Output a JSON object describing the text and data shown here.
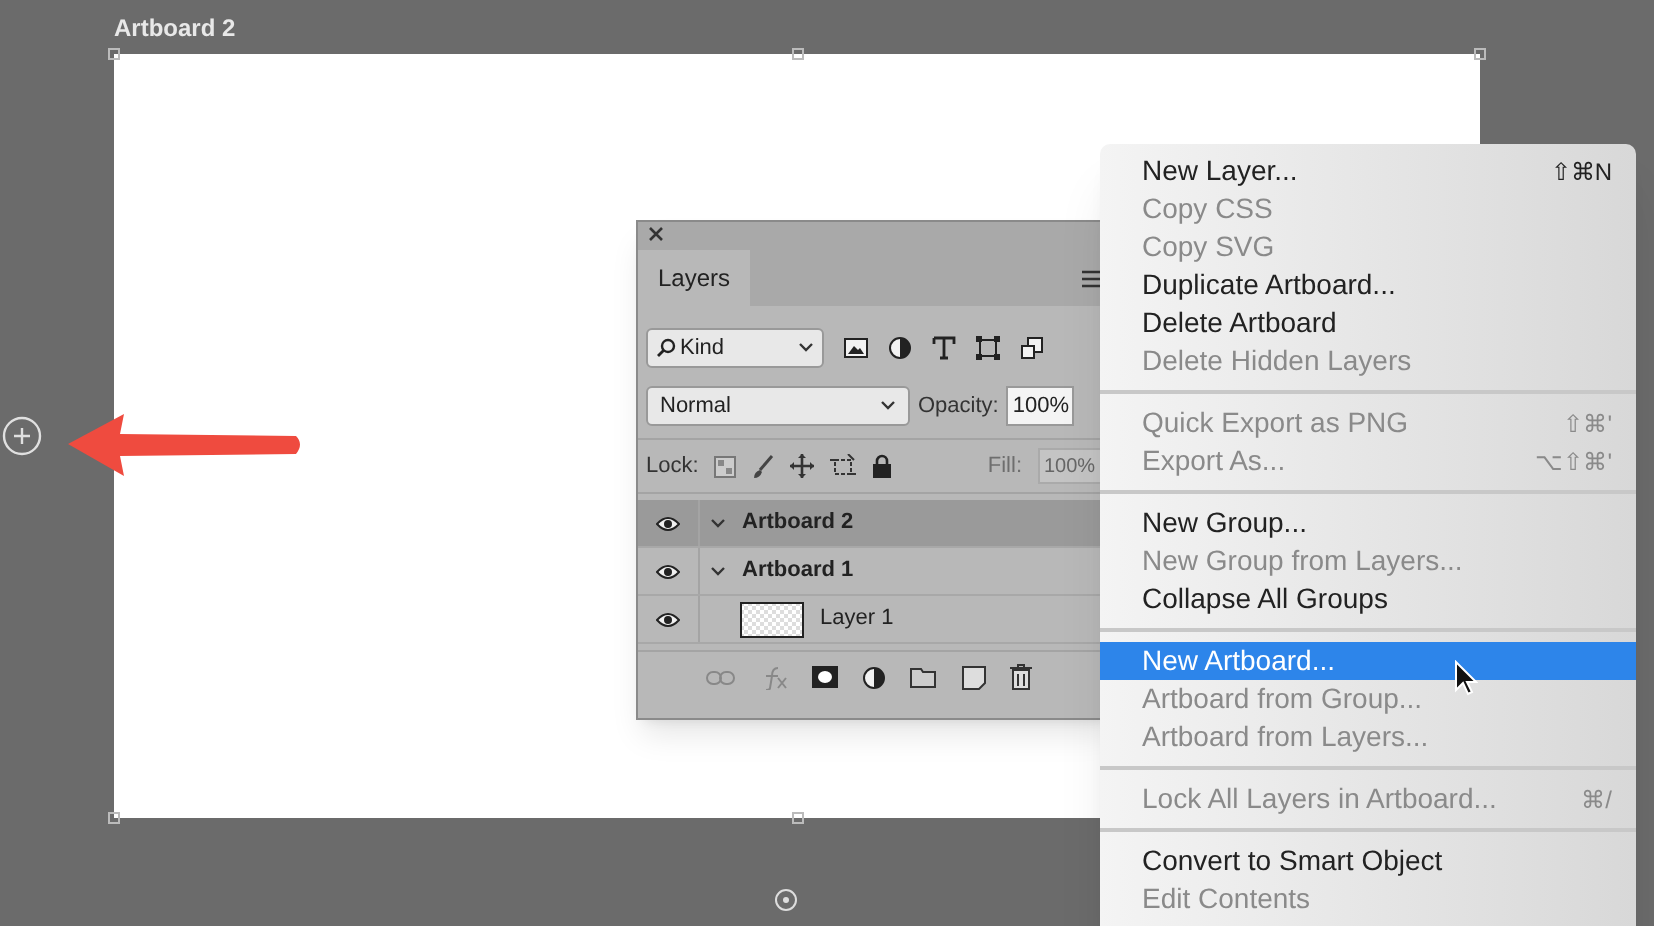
{
  "artboard": {
    "title": "Artboard 2"
  },
  "layers_panel": {
    "tab": {
      "label": "Layers",
      "selected": true
    },
    "filter": {
      "value": "Kind"
    },
    "blend_mode": {
      "value": "Normal"
    },
    "opacity": {
      "label": "Opacity:",
      "value": "100%"
    },
    "lock": {
      "label": "Lock:"
    },
    "fill": {
      "label": "Fill:",
      "value": "100%",
      "disabled": true
    },
    "layers": [
      {
        "name": "Artboard 2",
        "kind": "artboard",
        "visible": true,
        "selected": true,
        "expanded": true
      },
      {
        "name": "Artboard 1",
        "kind": "artboard",
        "visible": true,
        "selected": false,
        "expanded": true,
        "children": [
          {
            "name": "Layer 1",
            "kind": "layer",
            "visible": true,
            "selected": false
          }
        ]
      }
    ]
  },
  "context_menu": {
    "items": [
      {
        "kind": "item",
        "label": "New Layer...",
        "shortcut": "⇧⌘N",
        "disabled": false,
        "selected": false
      },
      {
        "kind": "item",
        "label": "Copy CSS",
        "disabled": true,
        "selected": false
      },
      {
        "kind": "item",
        "label": "Copy SVG",
        "disabled": true,
        "selected": false
      },
      {
        "kind": "item",
        "label": "Duplicate Artboard...",
        "disabled": false,
        "selected": false
      },
      {
        "kind": "item",
        "label": "Delete Artboard",
        "disabled": false,
        "selected": false
      },
      {
        "kind": "item",
        "label": "Delete Hidden Layers",
        "disabled": true,
        "selected": false
      },
      {
        "kind": "separator"
      },
      {
        "kind": "item",
        "label": "Quick Export as PNG",
        "shortcut": "⇧⌘'",
        "disabled": true,
        "selected": false
      },
      {
        "kind": "item",
        "label": "Export As...",
        "shortcut": "⌥⇧⌘'",
        "disabled": true,
        "selected": false
      },
      {
        "kind": "separator"
      },
      {
        "kind": "item",
        "label": "New Group...",
        "disabled": false,
        "selected": false
      },
      {
        "kind": "item",
        "label": "New Group from Layers...",
        "disabled": true,
        "selected": false
      },
      {
        "kind": "item",
        "label": "Collapse All Groups",
        "disabled": false,
        "selected": false
      },
      {
        "kind": "separator"
      },
      {
        "kind": "item",
        "label": "New Artboard...",
        "disabled": false,
        "selected": true
      },
      {
        "kind": "item",
        "label": "Artboard from Group...",
        "disabled": true,
        "selected": false
      },
      {
        "kind": "item",
        "label": "Artboard from Layers...",
        "disabled": true,
        "selected": false
      },
      {
        "kind": "separator"
      },
      {
        "kind": "item",
        "label": "Lock All Layers in Artboard...",
        "shortcut": "⌘/",
        "disabled": true,
        "selected": false
      },
      {
        "kind": "separator"
      },
      {
        "kind": "item",
        "label": "Convert to Smart Object",
        "disabled": false,
        "selected": false
      },
      {
        "kind": "item",
        "label": "Edit Contents",
        "disabled": true,
        "selected": false
      }
    ]
  }
}
